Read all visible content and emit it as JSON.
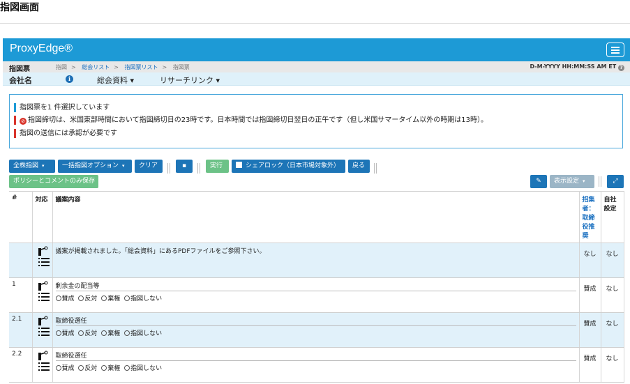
{
  "page_heading": "指図画面",
  "app": {
    "brand": "ProxyEdge®"
  },
  "crumbbar": {
    "title": "指図票",
    "crumbs": [
      "指図",
      "総会リスト",
      "指図票リスト",
      "指図票"
    ],
    "separator": ">",
    "timestamp": "D-M-YYYY HH:MM:SS AM ET",
    "help": "?"
  },
  "companybar": {
    "company_label": "会社名",
    "info_glyph": "i",
    "menu1": "総会資料",
    "menu2": "リサーチリンク",
    "caret": "▾"
  },
  "messages": [
    {
      "text": "指図票を1 件選択しています",
      "type": "info"
    },
    {
      "text": "指図締切は、米国東部時間において指図締切日の23時です。日本時間では指図締切日翌日の正午です（但し米国サマータイム以外の時期は13時）。",
      "type": "alert",
      "icon": "stop-icon"
    },
    {
      "text": "指図の送信には承認が必要です",
      "type": "alert"
    }
  ],
  "toolbar": {
    "bulk_instruct": "全株指図",
    "bulk_options": "一括指図オプション",
    "clear": "クリア",
    "execute": "実行",
    "share_lock": "シェアロック（日本市場対象外）",
    "back": "戻る",
    "save_policy": "ポリシーとコメントのみ保存",
    "display_settings": "表示設定",
    "caret": "▾"
  },
  "colors": {
    "brand": "#1d9ad6",
    "button": "#1d75b7",
    "green": "#6cc287",
    "alert": "#d9342b"
  },
  "table": {
    "headers": {
      "num": "#",
      "action": "対応",
      "proposal": "議案内容",
      "advisor": "招集者：取締役推奨",
      "own": "自社設定"
    },
    "rows": [
      {
        "num": "",
        "title": "議案が掲載されました。「総会資料」にあるPDFファイルをご参照下さい。",
        "has_vote": false,
        "advisor": "なし",
        "own": "なし",
        "shaded": true
      },
      {
        "num": "1",
        "title": "剰余金の配当等",
        "has_vote": true,
        "advisor": "賛成",
        "own": "なし",
        "shaded": false
      },
      {
        "num": "2.1",
        "title": "取締役選任",
        "has_vote": true,
        "advisor": "賛成",
        "own": "なし",
        "shaded": true
      },
      {
        "num": "2.2",
        "title": "取締役選任",
        "has_vote": true,
        "advisor": "賛成",
        "own": "なし",
        "shaded": false
      }
    ],
    "vote_options": [
      "賛成",
      "反対",
      "棄権",
      "指図しない"
    ]
  }
}
